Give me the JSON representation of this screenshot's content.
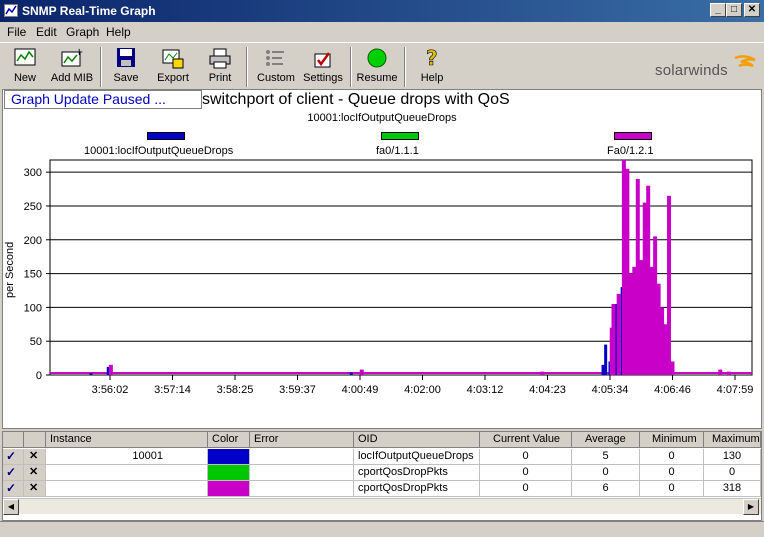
{
  "window": {
    "title": "SNMP Real-Time Graph"
  },
  "menu": [
    "File",
    "Edit",
    "Graph",
    "Help"
  ],
  "toolbar": [
    {
      "label": "New",
      "icon": "chart-new-icon"
    },
    {
      "label": "Add MIB",
      "icon": "add-mib-icon"
    },
    {
      "label": "Save",
      "icon": "floppy-icon"
    },
    {
      "label": "Export",
      "icon": "export-icon"
    },
    {
      "label": "Print",
      "icon": "printer-icon"
    },
    {
      "label": "Custom",
      "icon": "custom-icon"
    },
    {
      "label": "Settings",
      "icon": "settings-icon"
    },
    {
      "label": "Resume",
      "icon": "resume-icon"
    },
    {
      "label": "Help",
      "icon": "help-icon"
    }
  ],
  "brand": "solarwinds",
  "graph": {
    "status": "Graph Update Paused ...",
    "title": "switchport of client - Queue drops with QoS",
    "subtitle": "10001:locIfOutputQueueDrops",
    "legend": [
      {
        "name": "10001:locIfOutputQueueDrops",
        "color": "#0000c8"
      },
      {
        "name": "fa0/1.1.1",
        "color": "#00c800"
      },
      {
        "name": "Fa0/1.2.1",
        "color": "#c800c8"
      }
    ]
  },
  "chart_data": {
    "type": "bar",
    "ylabel": "per Second",
    "ylim": [
      0,
      320
    ],
    "yticks": [
      0,
      50,
      100,
      150,
      200,
      250,
      300
    ],
    "xticks": [
      "3:56:02",
      "3:57:14",
      "3:58:25",
      "3:59:37",
      "4:00:49",
      "4:02:00",
      "4:03:12",
      "4:04:23",
      "4:05:34",
      "4:06:46",
      "4:07:59"
    ],
    "grid": true,
    "series": [
      {
        "name": "10001:locIfOutputQueueDrops",
        "color": "#0000c8",
        "points": [
          [
            "3:55:40",
            3
          ],
          [
            "3:56:00",
            12
          ],
          [
            "4:00:40",
            4
          ],
          [
            "4:05:30",
            15
          ],
          [
            "4:05:33",
            45
          ],
          [
            "4:05:38",
            20
          ],
          [
            "4:05:45",
            105
          ],
          [
            "4:05:52",
            130
          ],
          [
            "4:06:00",
            120
          ],
          [
            "4:06:10",
            110
          ],
          [
            "4:06:20",
            95
          ],
          [
            "4:06:30",
            80
          ],
          [
            "4:06:38",
            40
          ]
        ]
      },
      {
        "name": "fa0/1.1.1",
        "color": "#00c800",
        "points": [
          [
            "4:05:40",
            2
          ],
          [
            "4:06:00",
            2
          ],
          [
            "4:06:30",
            2
          ]
        ]
      },
      {
        "name": "Fa0/1.2.1",
        "color": "#c800c8",
        "points": [
          [
            "3:56:03",
            15
          ],
          [
            "4:00:52",
            8
          ],
          [
            "4:04:20",
            5
          ],
          [
            "4:05:40",
            70
          ],
          [
            "4:05:42",
            105
          ],
          [
            "4:05:48",
            120
          ],
          [
            "4:05:54",
            318
          ],
          [
            "4:05:58",
            305
          ],
          [
            "4:06:02",
            150
          ],
          [
            "4:06:06",
            160
          ],
          [
            "4:06:10",
            290
          ],
          [
            "4:06:14",
            170
          ],
          [
            "4:06:18",
            255
          ],
          [
            "4:06:22",
            280
          ],
          [
            "4:06:26",
            160
          ],
          [
            "4:06:30",
            205
          ],
          [
            "4:06:34",
            135
          ],
          [
            "4:06:38",
            100
          ],
          [
            "4:06:42",
            75
          ],
          [
            "4:06:46",
            265
          ],
          [
            "4:06:50",
            20
          ],
          [
            "4:07:45",
            8
          ],
          [
            "4:07:55",
            5
          ]
        ]
      }
    ]
  },
  "table": {
    "columns": [
      "Instance",
      "Color",
      "Error",
      "OID",
      "Current Value",
      "Average",
      "Minimum",
      "Maximum"
    ],
    "rows": [
      {
        "instance": "10001",
        "color": "#0000c8",
        "error": "",
        "oid": "locIfOutputQueueDrops",
        "current": "0",
        "average": "5",
        "minimum": "0",
        "maximum": "130"
      },
      {
        "instance": "",
        "color": "#00c800",
        "error": "",
        "oid": "cportQosDropPkts",
        "current": "0",
        "average": "0",
        "minimum": "0",
        "maximum": "0"
      },
      {
        "instance": "",
        "color": "#c800c8",
        "error": "",
        "oid": "cportQosDropPkts",
        "current": "0",
        "average": "6",
        "minimum": "0",
        "maximum": "318"
      }
    ]
  }
}
